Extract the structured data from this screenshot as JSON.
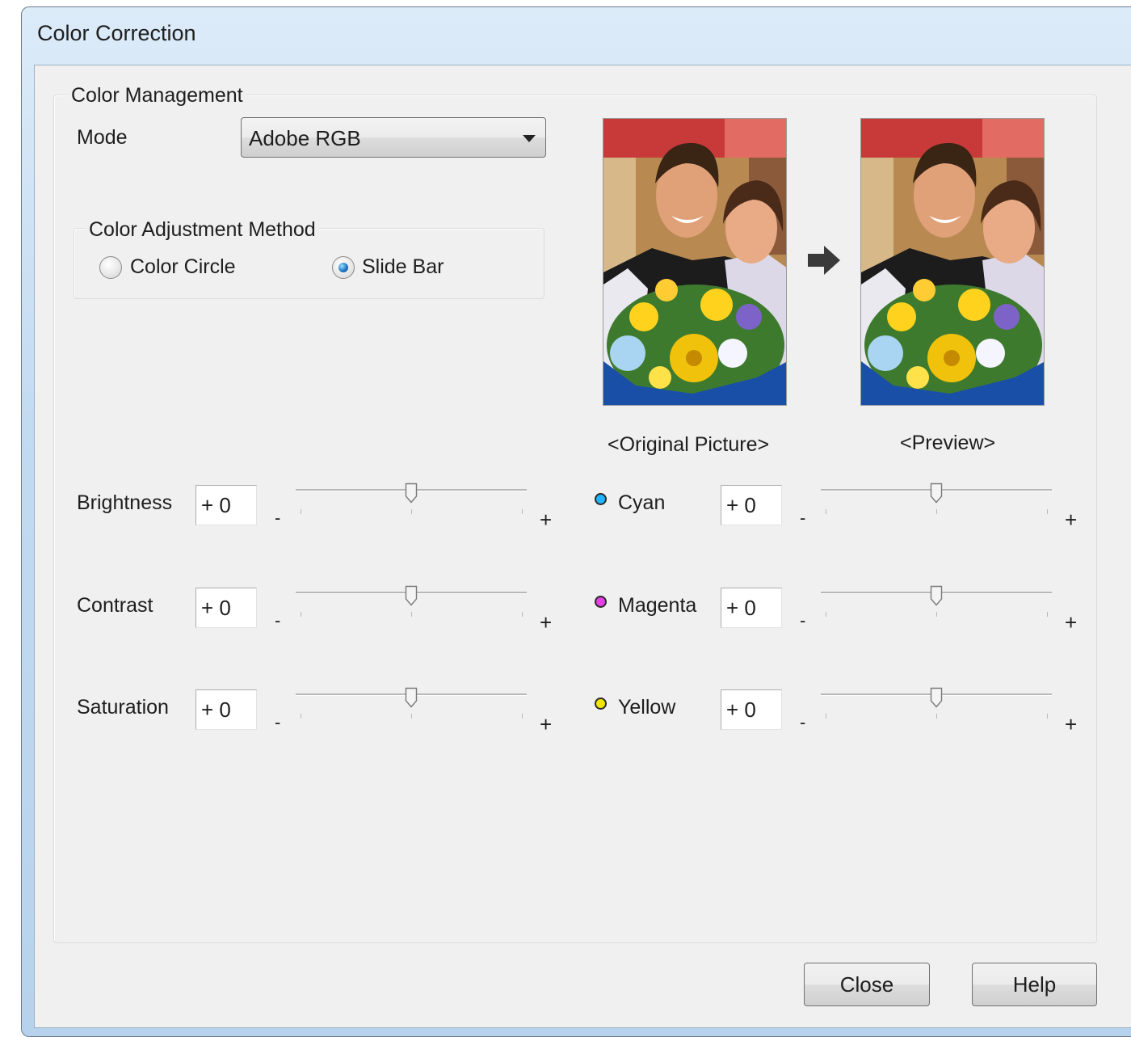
{
  "window": {
    "title": "Color Correction"
  },
  "color_management": {
    "legend": "Color Management",
    "mode_label": "Mode",
    "mode_value": "Adobe RGB",
    "method": {
      "legend": "Color Adjustment Method",
      "options": [
        {
          "label": "Color Circle",
          "selected": false
        },
        {
          "label": "Slide Bar",
          "selected": true
        }
      ]
    },
    "original_caption": "<Original Picture>",
    "preview_caption": "<Preview>"
  },
  "sliders": [
    {
      "label": "Brightness",
      "value": "+ 0",
      "level": 0
    },
    {
      "label": "Contrast",
      "value": "+ 0",
      "level": 0
    },
    {
      "label": "Saturation",
      "value": "+ 0",
      "level": 0
    },
    {
      "label": "Cyan",
      "value": "+ 0",
      "level": 0,
      "dot_color": "#1fb6ff"
    },
    {
      "label": "Magenta",
      "value": "+ 0",
      "level": 0,
      "dot_color": "#e53fe8"
    },
    {
      "label": "Yellow",
      "value": "+ 0",
      "level": 0,
      "dot_color": "#f2e600"
    }
  ],
  "slider_minus": "-",
  "slider_plus": "+",
  "buttons": {
    "close": "Close",
    "help": "Help"
  }
}
